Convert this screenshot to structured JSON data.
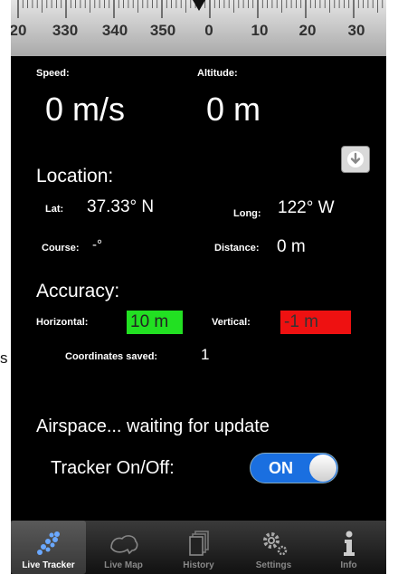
{
  "compass": {
    "labels": [
      "20",
      "330",
      "340",
      "350",
      "0",
      "10",
      "20",
      "30"
    ]
  },
  "side_mark": "s",
  "speed": {
    "label": "Speed:",
    "value": "0 m/s"
  },
  "altitude": {
    "label": "Altitude:",
    "value": "0 m"
  },
  "location": {
    "header": "Location:",
    "lat_label": "Lat:",
    "lat_value": "37.33° N",
    "long_label": "Long:",
    "long_value": "122° W",
    "course_label": "Course:",
    "course_value": "-°",
    "distance_label": "Distance:",
    "distance_value": "0 m"
  },
  "accuracy": {
    "header": "Accuracy:",
    "horizontal_label": "Horizontal:",
    "horizontal_value": "10 m",
    "vertical_label": "Vertical:",
    "vertical_value": "-1 m",
    "coords_label": "Coordinates saved:",
    "coords_value": "1"
  },
  "airspace_status": "Airspace... waiting for update",
  "tracker": {
    "label": "Tracker On/Off:",
    "state": "ON"
  },
  "tabs": [
    {
      "label": "Live Tracker",
      "icon": "live-tracker-icon",
      "active": true
    },
    {
      "label": "Live Map",
      "icon": "map-icon",
      "active": false
    },
    {
      "label": "History",
      "icon": "history-icon",
      "active": false
    },
    {
      "label": "Settings",
      "icon": "gear-icon",
      "active": false
    },
    {
      "label": "Info",
      "icon": "info-icon",
      "active": false
    }
  ],
  "colors": {
    "horizontal_ok": "#22e022",
    "vertical_bad": "#ee1111",
    "toggle_on": "#1a6fe0"
  }
}
